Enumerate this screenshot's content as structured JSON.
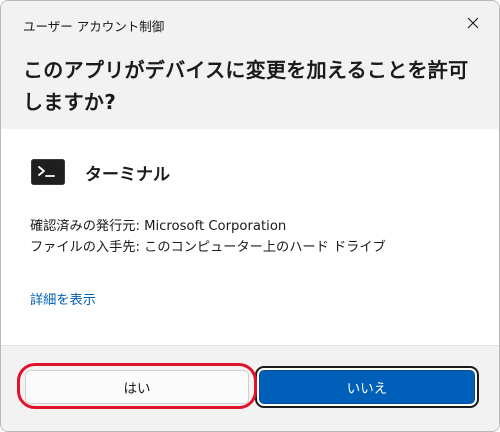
{
  "window": {
    "title": "ユーザー アカウント制御",
    "question": "このアプリがデバイスに変更を加えることを許可しますか?"
  },
  "app": {
    "icon": "terminal-icon",
    "name": "ターミナル"
  },
  "info": {
    "publisher": "確認済みの発行元: Microsoft Corporation",
    "origin": "ファイルの入手先: このコンピューター上のハード ドライブ"
  },
  "links": {
    "details": "詳細を表示"
  },
  "buttons": {
    "yes": "はい",
    "no": "いいえ"
  },
  "colors": {
    "header_bg": "#f2f2f2",
    "accent": "#005fb8",
    "highlight": "#e0132b",
    "link": "#005fb8"
  }
}
